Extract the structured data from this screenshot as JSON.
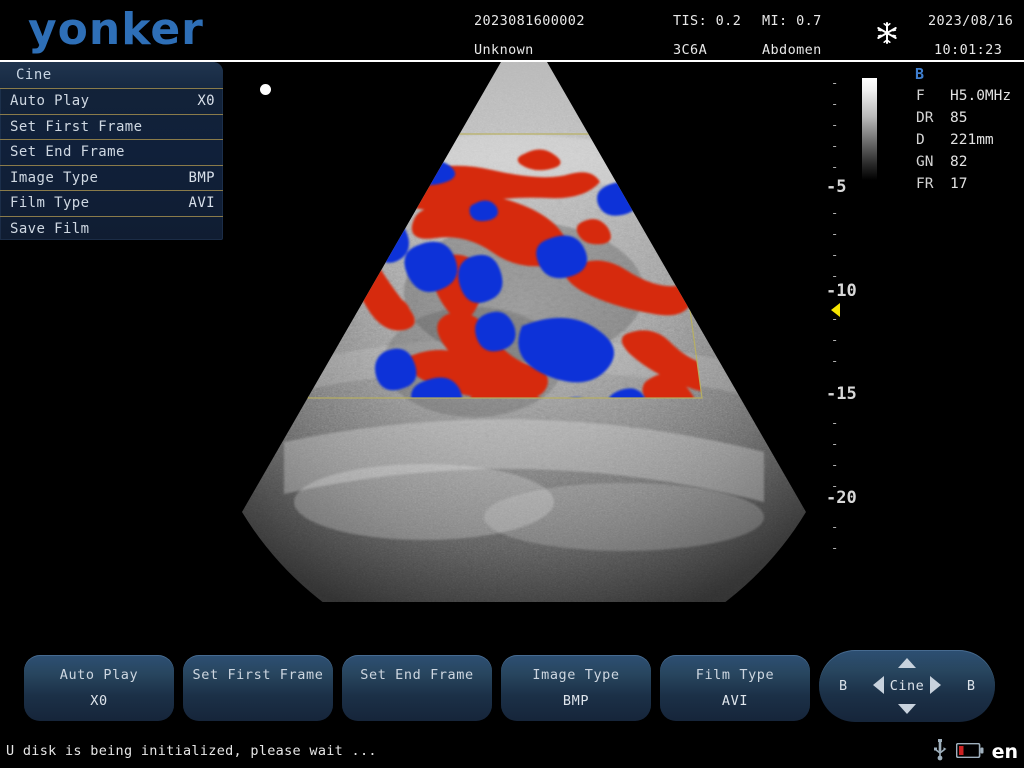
{
  "header": {
    "logo": "yonker",
    "patient_id": "2023081600002",
    "patient_name": "Unknown",
    "tis": "TIS: 0.2",
    "mi": "MI: 0.7",
    "probe": "3C6A",
    "exam_part": "Abdomen",
    "date": "2023/08/16",
    "time": "10:01:23",
    "freeze_icon": "snowflake-icon"
  },
  "menu": {
    "title": "Cine",
    "items": [
      {
        "label": "Auto Play",
        "value": "X0"
      },
      {
        "label": "Set First Frame",
        "value": ""
      },
      {
        "label": "Set End Frame",
        "value": ""
      },
      {
        "label": "Image Type",
        "value": "BMP"
      },
      {
        "label": "Film Type",
        "value": "AVI"
      },
      {
        "label": "Save Film",
        "value": ""
      }
    ]
  },
  "image": {
    "mode": "color-doppler-sector",
    "roi_color": "#b8b060",
    "flow_forward_color": "#d62a10",
    "flow_reverse_color": "#1030d8",
    "cursor_marker": "orientation-dot"
  },
  "scale": {
    "major_ticks": [
      "-5",
      "-10",
      "-15",
      "-20"
    ],
    "minor_tick": "-",
    "marker_color": "#f5e400",
    "grayscale_bar": {
      "top_color": "#ffffff",
      "bottom_color": "#000000"
    }
  },
  "params": {
    "mode": "B",
    "rows": [
      {
        "key": "F",
        "value": "H5.0MHz"
      },
      {
        "key": "DR",
        "value": "85"
      },
      {
        "key": "D",
        "value": "221mm"
      },
      {
        "key": "GN",
        "value": "82"
      },
      {
        "key": "FR",
        "value": "17"
      }
    ]
  },
  "buttons": [
    {
      "label": "Auto Play",
      "value": "X0"
    },
    {
      "label": "Set First Frame",
      "value": ""
    },
    {
      "label": "Set End Frame",
      "value": ""
    },
    {
      "label": "Image Type",
      "value": "BMP"
    },
    {
      "label": "Film Type",
      "value": "AVI"
    }
  ],
  "navpad": {
    "left_label": "B",
    "center_label": "Cine",
    "right_label": "B"
  },
  "status": {
    "message": "U disk is being initialized, please wait ...",
    "usb_icon": "usb-icon",
    "battery_icon": "battery-low-icon",
    "language": "en"
  },
  "colors": {
    "accent_blue": "#2e6fb7",
    "menu_bg": "#132338",
    "menu_divider": "#8a7b4a",
    "button_blue": "#2d4f73",
    "battery_red": "#cc2222"
  }
}
